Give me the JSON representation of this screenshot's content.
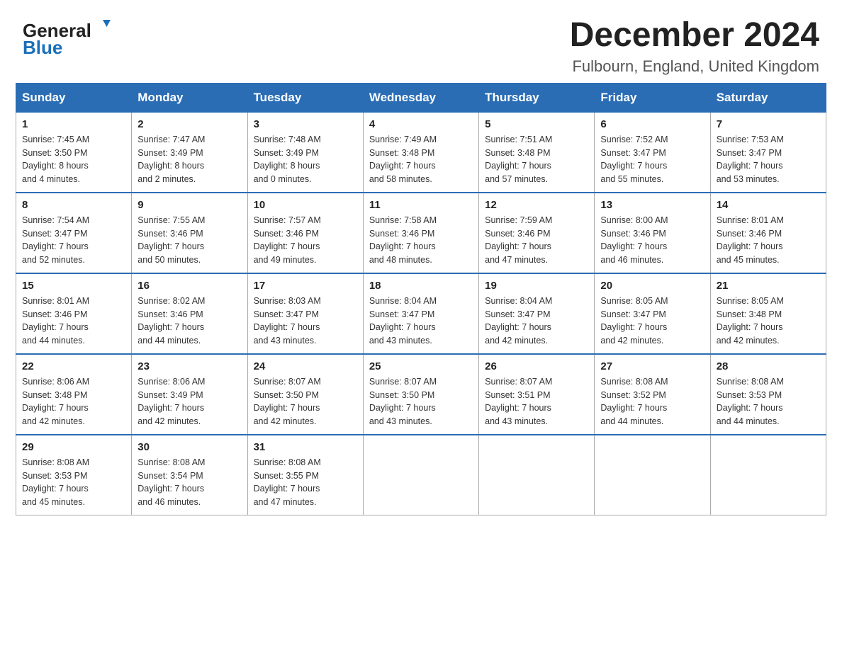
{
  "header": {
    "logo_general": "General",
    "logo_blue": "Blue",
    "month_title": "December 2024",
    "subtitle": "Fulbourn, England, United Kingdom"
  },
  "days_of_week": [
    "Sunday",
    "Monday",
    "Tuesday",
    "Wednesday",
    "Thursday",
    "Friday",
    "Saturday"
  ],
  "weeks": [
    [
      {
        "day": "1",
        "sunrise": "7:45 AM",
        "sunset": "3:50 PM",
        "daylight": "8 hours and 4 minutes."
      },
      {
        "day": "2",
        "sunrise": "7:47 AM",
        "sunset": "3:49 PM",
        "daylight": "8 hours and 2 minutes."
      },
      {
        "day": "3",
        "sunrise": "7:48 AM",
        "sunset": "3:49 PM",
        "daylight": "8 hours and 0 minutes."
      },
      {
        "day": "4",
        "sunrise": "7:49 AM",
        "sunset": "3:48 PM",
        "daylight": "7 hours and 58 minutes."
      },
      {
        "day": "5",
        "sunrise": "7:51 AM",
        "sunset": "3:48 PM",
        "daylight": "7 hours and 57 minutes."
      },
      {
        "day": "6",
        "sunrise": "7:52 AM",
        "sunset": "3:47 PM",
        "daylight": "7 hours and 55 minutes."
      },
      {
        "day": "7",
        "sunrise": "7:53 AM",
        "sunset": "3:47 PM",
        "daylight": "7 hours and 53 minutes."
      }
    ],
    [
      {
        "day": "8",
        "sunrise": "7:54 AM",
        "sunset": "3:47 PM",
        "daylight": "7 hours and 52 minutes."
      },
      {
        "day": "9",
        "sunrise": "7:55 AM",
        "sunset": "3:46 PM",
        "daylight": "7 hours and 50 minutes."
      },
      {
        "day": "10",
        "sunrise": "7:57 AM",
        "sunset": "3:46 PM",
        "daylight": "7 hours and 49 minutes."
      },
      {
        "day": "11",
        "sunrise": "7:58 AM",
        "sunset": "3:46 PM",
        "daylight": "7 hours and 48 minutes."
      },
      {
        "day": "12",
        "sunrise": "7:59 AM",
        "sunset": "3:46 PM",
        "daylight": "7 hours and 47 minutes."
      },
      {
        "day": "13",
        "sunrise": "8:00 AM",
        "sunset": "3:46 PM",
        "daylight": "7 hours and 46 minutes."
      },
      {
        "day": "14",
        "sunrise": "8:01 AM",
        "sunset": "3:46 PM",
        "daylight": "7 hours and 45 minutes."
      }
    ],
    [
      {
        "day": "15",
        "sunrise": "8:01 AM",
        "sunset": "3:46 PM",
        "daylight": "7 hours and 44 minutes."
      },
      {
        "day": "16",
        "sunrise": "8:02 AM",
        "sunset": "3:46 PM",
        "daylight": "7 hours and 44 minutes."
      },
      {
        "day": "17",
        "sunrise": "8:03 AM",
        "sunset": "3:47 PM",
        "daylight": "7 hours and 43 minutes."
      },
      {
        "day": "18",
        "sunrise": "8:04 AM",
        "sunset": "3:47 PM",
        "daylight": "7 hours and 43 minutes."
      },
      {
        "day": "19",
        "sunrise": "8:04 AM",
        "sunset": "3:47 PM",
        "daylight": "7 hours and 42 minutes."
      },
      {
        "day": "20",
        "sunrise": "8:05 AM",
        "sunset": "3:47 PM",
        "daylight": "7 hours and 42 minutes."
      },
      {
        "day": "21",
        "sunrise": "8:05 AM",
        "sunset": "3:48 PM",
        "daylight": "7 hours and 42 minutes."
      }
    ],
    [
      {
        "day": "22",
        "sunrise": "8:06 AM",
        "sunset": "3:48 PM",
        "daylight": "7 hours and 42 minutes."
      },
      {
        "day": "23",
        "sunrise": "8:06 AM",
        "sunset": "3:49 PM",
        "daylight": "7 hours and 42 minutes."
      },
      {
        "day": "24",
        "sunrise": "8:07 AM",
        "sunset": "3:50 PM",
        "daylight": "7 hours and 42 minutes."
      },
      {
        "day": "25",
        "sunrise": "8:07 AM",
        "sunset": "3:50 PM",
        "daylight": "7 hours and 43 minutes."
      },
      {
        "day": "26",
        "sunrise": "8:07 AM",
        "sunset": "3:51 PM",
        "daylight": "7 hours and 43 minutes."
      },
      {
        "day": "27",
        "sunrise": "8:08 AM",
        "sunset": "3:52 PM",
        "daylight": "7 hours and 44 minutes."
      },
      {
        "day": "28",
        "sunrise": "8:08 AM",
        "sunset": "3:53 PM",
        "daylight": "7 hours and 44 minutes."
      }
    ],
    [
      {
        "day": "29",
        "sunrise": "8:08 AM",
        "sunset": "3:53 PM",
        "daylight": "7 hours and 45 minutes."
      },
      {
        "day": "30",
        "sunrise": "8:08 AM",
        "sunset": "3:54 PM",
        "daylight": "7 hours and 46 minutes."
      },
      {
        "day": "31",
        "sunrise": "8:08 AM",
        "sunset": "3:55 PM",
        "daylight": "7 hours and 47 minutes."
      },
      null,
      null,
      null,
      null
    ]
  ]
}
